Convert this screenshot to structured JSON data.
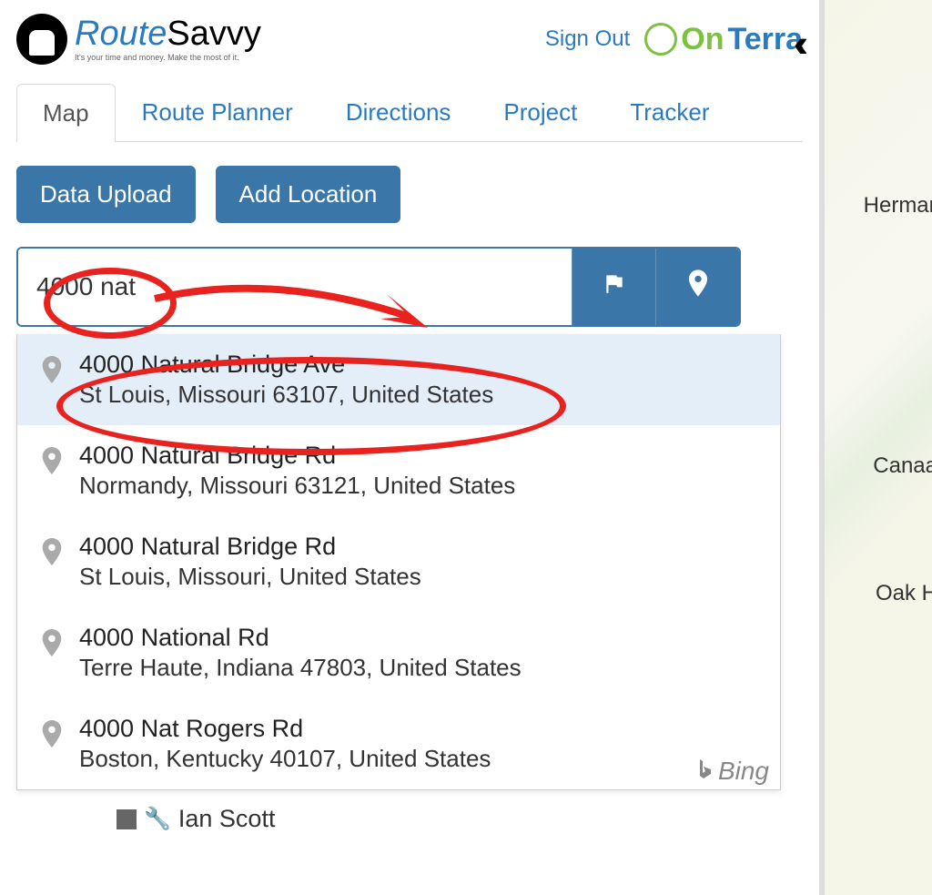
{
  "header": {
    "logo_text_prefix": "Route",
    "logo_text_suffix": "Savvy",
    "logo_subtitle": "It's your time and money. Make the most of it.",
    "signout": "Sign Out",
    "partner_prefix": "On",
    "partner_suffix": "Terra"
  },
  "tabs": [
    {
      "label": "Map",
      "active": true
    },
    {
      "label": "Route Planner",
      "active": false
    },
    {
      "label": "Directions",
      "active": false
    },
    {
      "label": "Project",
      "active": false
    },
    {
      "label": "Tracker",
      "active": false
    }
  ],
  "toolbar": {
    "upload": "Data Upload",
    "add": "Add Location"
  },
  "search": {
    "value": "4000 nat"
  },
  "suggestions": [
    {
      "line1": "4000 Natural Bridge Ave",
      "line2": "St Louis, Missouri 63107, United States",
      "highlight": true
    },
    {
      "line1": "4000 Natural Bridge Rd",
      "line2": "Normandy, Missouri 63121, United States",
      "highlight": false
    },
    {
      "line1": "4000 Natural Bridge Rd",
      "line2": "St Louis, Missouri, United States",
      "highlight": false
    },
    {
      "line1": "4000 National Rd",
      "line2": "Terre Haute, Indiana 47803, United States",
      "highlight": false
    },
    {
      "line1": "4000 Nat Rogers Rd",
      "line2": "Boston, Kentucky 40107, United States",
      "highlight": false
    }
  ],
  "credit": "Bing",
  "list_item": "Ian Scott",
  "map_labels": {
    "herman": "Herman",
    "canaa": "Canaa",
    "oakh": "Oak H"
  }
}
